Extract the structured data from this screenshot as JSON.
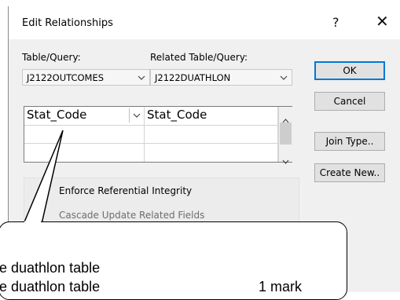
{
  "dialog": {
    "title": "Edit Relationships",
    "help_label": "?",
    "close_label": "✕"
  },
  "labels": {
    "table_query": "Table/Query:",
    "related_table_query": "Related Table/Query:"
  },
  "combos": {
    "table": "J2122OUTCOMES",
    "related": "J2122DUATHLON"
  },
  "grid": {
    "rows": [
      {
        "left": "Stat_Code",
        "right": "Stat_Code"
      }
    ]
  },
  "buttons": {
    "ok": "OK",
    "cancel": "Cancel",
    "join_type": "Join Type..",
    "create_new": "Create New.."
  },
  "options": {
    "enforce": "Enforce Referential Integrity",
    "cascade_update": "Cascade Update Related Fields"
  },
  "callout": {
    "line1": "e duathlon table",
    "line2": "e duathlon table",
    "marks": "1 mark"
  }
}
